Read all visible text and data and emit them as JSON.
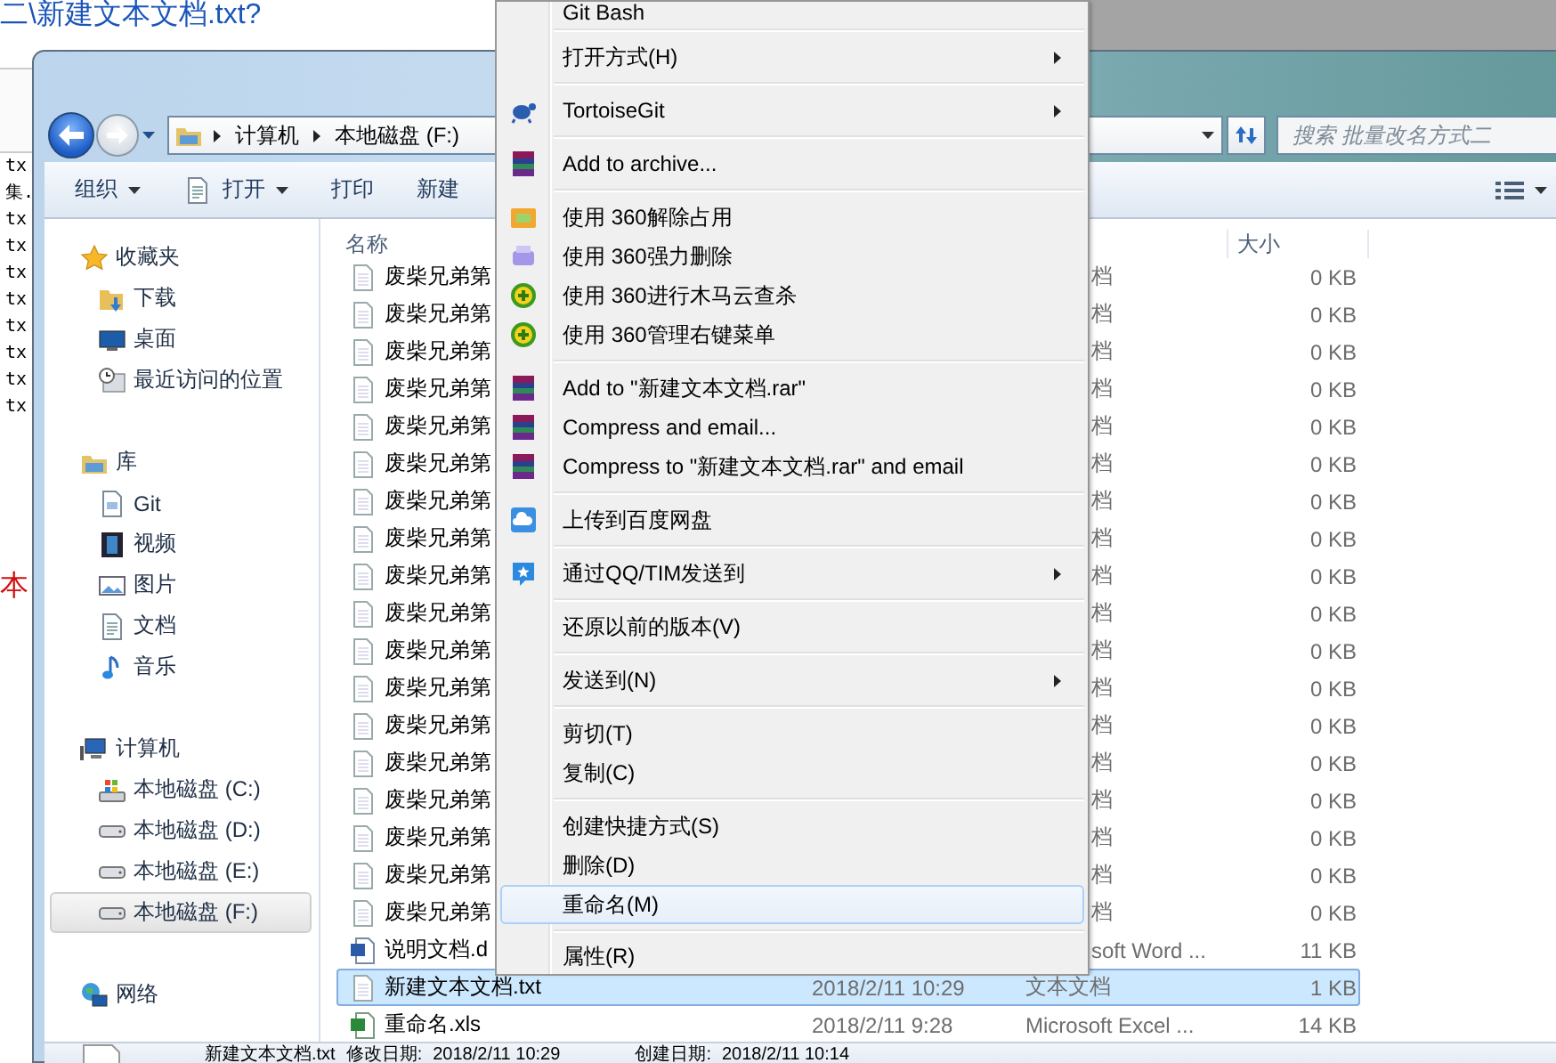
{
  "background": {
    "heading": "二\\新建文本文档.txt?",
    "console_lines": [
      "tx",
      "集.",
      "tx",
      "tx",
      "tx",
      "tx",
      "tx",
      "tx",
      "tx",
      "tx"
    ],
    "side_text": "本"
  },
  "explorer": {
    "breadcrumbs": [
      "计算机",
      "本地磁盘 (F:)"
    ],
    "search": {
      "placeholder": "搜索 批量改名方式二"
    },
    "toolbar": [
      {
        "label": "组织",
        "kind": "menu"
      },
      {
        "label": "打开",
        "kind": "split"
      },
      {
        "label": "打印",
        "kind": "plain"
      },
      {
        "label": "新建",
        "kind": "plain"
      }
    ],
    "nav": [
      {
        "label": "收藏夹",
        "kind": "star",
        "selected": false,
        "children": [
          {
            "label": "下载",
            "kind": "download-folder",
            "selected": false
          },
          {
            "label": "桌面",
            "kind": "desktop",
            "selected": false
          },
          {
            "label": "最近访问的位置",
            "kind": "recent",
            "selected": false
          }
        ]
      },
      {
        "label": "库",
        "kind": "library",
        "selected": false,
        "children": [
          {
            "label": "Git",
            "kind": "gitlib",
            "selected": false
          },
          {
            "label": "视频",
            "kind": "video",
            "selected": false
          },
          {
            "label": "图片",
            "kind": "picture",
            "selected": false
          },
          {
            "label": "文档",
            "kind": "document",
            "selected": false
          },
          {
            "label": "音乐",
            "kind": "music",
            "selected": false
          }
        ]
      },
      {
        "label": "计算机",
        "kind": "computer",
        "selected": false,
        "children": [
          {
            "label": "本地磁盘 (C:)",
            "kind": "system-drive",
            "selected": false
          },
          {
            "label": "本地磁盘 (D:)",
            "kind": "drive",
            "selected": false
          },
          {
            "label": "本地磁盘 (E:)",
            "kind": "drive",
            "selected": false
          },
          {
            "label": "本地磁盘 (F:)",
            "kind": "drive",
            "selected": true
          }
        ]
      },
      {
        "label": "网络",
        "kind": "network",
        "selected": false
      }
    ],
    "columns": [
      "名称",
      "大小"
    ],
    "files": [
      {
        "name": "废柴兄弟第",
        "type": "档",
        "size": "0 KB",
        "kind": "text",
        "selected": false
      },
      {
        "name": "废柴兄弟第",
        "type": "档",
        "size": "0 KB",
        "kind": "text",
        "selected": false
      },
      {
        "name": "废柴兄弟第",
        "type": "档",
        "size": "0 KB",
        "kind": "text",
        "selected": false
      },
      {
        "name": "废柴兄弟第",
        "type": "档",
        "size": "0 KB",
        "kind": "text",
        "selected": false
      },
      {
        "name": "废柴兄弟第",
        "type": "档",
        "size": "0 KB",
        "kind": "text",
        "selected": false
      },
      {
        "name": "废柴兄弟第",
        "type": "档",
        "size": "0 KB",
        "kind": "text",
        "selected": false
      },
      {
        "name": "废柴兄弟第",
        "type": "档",
        "size": "0 KB",
        "kind": "text",
        "selected": false
      },
      {
        "name": "废柴兄弟第",
        "type": "档",
        "size": "0 KB",
        "kind": "text",
        "selected": false
      },
      {
        "name": "废柴兄弟第",
        "type": "档",
        "size": "0 KB",
        "kind": "text",
        "selected": false
      },
      {
        "name": "废柴兄弟第",
        "type": "档",
        "size": "0 KB",
        "kind": "text",
        "selected": false
      },
      {
        "name": "废柴兄弟第",
        "type": "档",
        "size": "0 KB",
        "kind": "text",
        "selected": false
      },
      {
        "name": "废柴兄弟第",
        "type": "档",
        "size": "0 KB",
        "kind": "text",
        "selected": false
      },
      {
        "name": "废柴兄弟第",
        "type": "档",
        "size": "0 KB",
        "kind": "text",
        "selected": false
      },
      {
        "name": "废柴兄弟第",
        "type": "档",
        "size": "0 KB",
        "kind": "text",
        "selected": false
      },
      {
        "name": "废柴兄弟第",
        "type": "档",
        "size": "0 KB",
        "kind": "text",
        "selected": false
      },
      {
        "name": "废柴兄弟第",
        "type": "档",
        "size": "0 KB",
        "kind": "text",
        "selected": false
      },
      {
        "name": "废柴兄弟第",
        "type": "档",
        "size": "0 KB",
        "kind": "text",
        "selected": false
      },
      {
        "name": "废柴兄弟第",
        "type": "档",
        "size": "0 KB",
        "kind": "text",
        "selected": false
      },
      {
        "name": "说明文档.d",
        "type": "soft Word ...",
        "size": "11 KB",
        "kind": "word",
        "selected": false
      },
      {
        "name": "新建文本文档.txt",
        "date": "2018/2/11 10:29",
        "type": "文本文档",
        "size": "1 KB",
        "kind": "text",
        "selected": true
      },
      {
        "name": "重命名.xls",
        "date": "2018/2/11 9:28",
        "type": "Microsoft Excel ...",
        "size": "14 KB",
        "kind": "excel",
        "selected": false
      }
    ],
    "details": {
      "name": "新建文本文档.txt",
      "modified_label": "修改日期:",
      "modified": "2018/2/11 10:29",
      "created_label": "创建日期:",
      "created": "2018/2/11 10:14"
    }
  },
  "context_menu": {
    "items": [
      {
        "kind": "plain",
        "label": "Git Bash",
        "submenu": false,
        "selected": false
      },
      {
        "kind": "separator"
      },
      {
        "kind": "plain",
        "label": "打开方式(H)",
        "submenu": true,
        "selected": false
      },
      {
        "kind": "separator"
      },
      {
        "kind": "tortoise",
        "label": "TortoiseGit",
        "submenu": true,
        "selected": false
      },
      {
        "kind": "separator"
      },
      {
        "kind": "archive",
        "label": "Add to archive...",
        "submenu": false,
        "selected": false
      },
      {
        "kind": "separator"
      },
      {
        "kind": "unlock",
        "label": "使用 360解除占用",
        "submenu": false,
        "selected": false
      },
      {
        "kind": "shred",
        "label": "使用 360强力删除",
        "submenu": false,
        "selected": false
      },
      {
        "kind": "plus",
        "label": "使用 360进行木马云查杀",
        "submenu": false,
        "selected": false
      },
      {
        "kind": "plus",
        "label": "使用 360管理右键菜单",
        "submenu": false,
        "selected": false
      },
      {
        "kind": "separator"
      },
      {
        "kind": "archive",
        "label": "Add to \"新建文本文档.rar\"",
        "submenu": false,
        "selected": false
      },
      {
        "kind": "archive",
        "label": "Compress and email...",
        "submenu": false,
        "selected": false
      },
      {
        "kind": "archive",
        "label": "Compress to \"新建文本文档.rar\" and email",
        "submenu": false,
        "selected": false
      },
      {
        "kind": "separator"
      },
      {
        "kind": "cloud",
        "label": "上传到百度网盘",
        "submenu": false,
        "selected": false
      },
      {
        "kind": "separator"
      },
      {
        "kind": "chat",
        "label": "通过QQ/TIM发送到",
        "submenu": true,
        "selected": false
      },
      {
        "kind": "separator"
      },
      {
        "kind": "plain",
        "label": "还原以前的版本(V)",
        "submenu": false,
        "selected": false
      },
      {
        "kind": "separator"
      },
      {
        "kind": "plain",
        "label": "发送到(N)",
        "submenu": true,
        "selected": false
      },
      {
        "kind": "separator"
      },
      {
        "kind": "plain",
        "label": "剪切(T)",
        "submenu": false,
        "selected": false
      },
      {
        "kind": "plain",
        "label": "复制(C)",
        "submenu": false,
        "selected": false
      },
      {
        "kind": "separator"
      },
      {
        "kind": "plain",
        "label": "创建快捷方式(S)",
        "submenu": false,
        "selected": false
      },
      {
        "kind": "plain",
        "label": "删除(D)",
        "submenu": false,
        "selected": false
      },
      {
        "kind": "plain",
        "label": "重命名(M)",
        "submenu": false,
        "selected": true
      },
      {
        "kind": "separator"
      },
      {
        "kind": "plain",
        "label": "属性(R)",
        "submenu": false,
        "selected": false
      }
    ]
  }
}
